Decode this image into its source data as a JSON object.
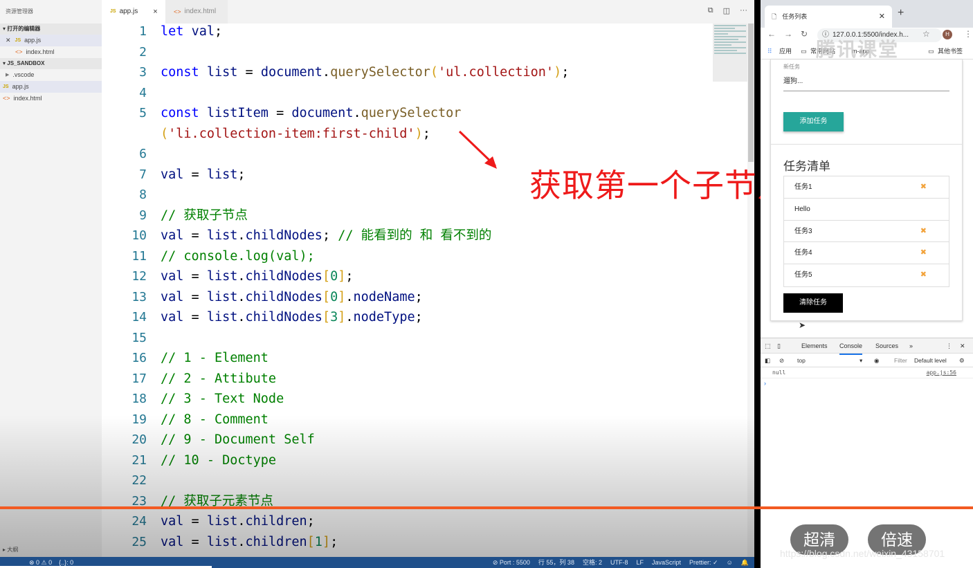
{
  "explorer": {
    "title": "资源管理器",
    "open_editors": "打开的编辑器",
    "open_files": [
      "app.js",
      "index.html"
    ],
    "workspace": "JS_SANDBOX",
    "tree": [
      ".vscode",
      "app.js",
      "index.html"
    ],
    "outline": "大纲"
  },
  "tabs": [
    {
      "label": "app.js",
      "close": "×"
    },
    {
      "label": "index.html"
    }
  ],
  "code": {
    "line_numbers": [
      "1",
      "2",
      "3",
      "4",
      "5",
      "",
      "6",
      "7",
      "8",
      "9",
      "10",
      "11",
      "12",
      "13",
      "14",
      "15",
      "16",
      "17",
      "18",
      "19",
      "20",
      "21",
      "22",
      "23",
      "24",
      "25"
    ],
    "lines": [
      [
        [
          "kw",
          "let "
        ],
        [
          "vr",
          "val"
        ],
        [
          "",
          "; "
        ]
      ],
      [],
      [
        [
          "kw",
          "const "
        ],
        [
          "vr",
          "list"
        ],
        [
          "",
          " = "
        ],
        [
          "vr",
          "document"
        ],
        [
          "",
          "."
        ],
        [
          "fn",
          "querySelector"
        ],
        [
          "br",
          "("
        ],
        [
          "st",
          "'ul.collection'"
        ],
        [
          "br",
          ")"
        ],
        [
          "",
          ";"
        ]
      ],
      [],
      [
        [
          "kw",
          "const "
        ],
        [
          "vr",
          "listItem"
        ],
        [
          "",
          " = "
        ],
        [
          "vr",
          "document"
        ],
        [
          "",
          "."
        ],
        [
          "fn",
          "querySelector"
        ]
      ],
      [
        [
          "br",
          "("
        ],
        [
          "st",
          "'li.collection-item:first-child'"
        ],
        [
          "br",
          ")"
        ],
        [
          "",
          ";"
        ]
      ],
      [],
      [
        [
          "vr",
          "val"
        ],
        [
          "",
          " = "
        ],
        [
          "vr",
          "list"
        ],
        [
          "",
          ";"
        ]
      ],
      [],
      [
        [
          "cm",
          "// 获取子节点"
        ]
      ],
      [
        [
          "vr",
          "val"
        ],
        [
          "",
          " = "
        ],
        [
          "vr",
          "list"
        ],
        [
          "",
          "."
        ],
        [
          "vr",
          "childNodes"
        ],
        [
          "",
          "; "
        ],
        [
          "cm",
          "// 能看到的 和 看不到的"
        ]
      ],
      [
        [
          "cm",
          "// console.log(val);"
        ]
      ],
      [
        [
          "vr",
          "val"
        ],
        [
          "",
          " = "
        ],
        [
          "vr",
          "list"
        ],
        [
          "",
          "."
        ],
        [
          "vr",
          "childNodes"
        ],
        [
          "br",
          "["
        ],
        [
          "nm",
          "0"
        ],
        [
          "br",
          "]"
        ],
        [
          "",
          ";"
        ]
      ],
      [
        [
          "vr",
          "val"
        ],
        [
          "",
          " = "
        ],
        [
          "vr",
          "list"
        ],
        [
          "",
          "."
        ],
        [
          "vr",
          "childNodes"
        ],
        [
          "br",
          "["
        ],
        [
          "nm",
          "0"
        ],
        [
          "br",
          "]"
        ],
        [
          "",
          "."
        ],
        [
          "vr",
          "nodeName"
        ],
        [
          "",
          ";"
        ]
      ],
      [
        [
          "vr",
          "val"
        ],
        [
          "",
          " = "
        ],
        [
          "vr",
          "list"
        ],
        [
          "",
          "."
        ],
        [
          "vr",
          "childNodes"
        ],
        [
          "br",
          "["
        ],
        [
          "nm",
          "3"
        ],
        [
          "br",
          "]"
        ],
        [
          "",
          "."
        ],
        [
          "vr",
          "nodeType"
        ],
        [
          "",
          ";"
        ]
      ],
      [],
      [
        [
          "cm",
          "// 1 - Element"
        ]
      ],
      [
        [
          "cm",
          "// 2 - Attibute"
        ]
      ],
      [
        [
          "cm",
          "// 3 - Text Node"
        ]
      ],
      [
        [
          "cm",
          "// 8 - Comment"
        ]
      ],
      [
        [
          "cm",
          "// 9 - Document Self"
        ]
      ],
      [
        [
          "cm",
          "// 10 - Doctype"
        ]
      ],
      [],
      [
        [
          "cm",
          "// 获取子元素节点"
        ]
      ],
      [
        [
          "vr",
          "val"
        ],
        [
          "",
          " = "
        ],
        [
          "vr",
          "list"
        ],
        [
          "",
          "."
        ],
        [
          "vr",
          "children"
        ],
        [
          "",
          ";"
        ]
      ],
      [
        [
          "vr",
          "val"
        ],
        [
          "",
          " = "
        ],
        [
          "vr",
          "list"
        ],
        [
          "",
          "."
        ],
        [
          "vr",
          "children"
        ],
        [
          "br",
          "["
        ],
        [
          "nm",
          "1"
        ],
        [
          "br",
          "]"
        ],
        [
          "",
          ";"
        ]
      ]
    ]
  },
  "annotation": "获取第一个子节点",
  "statusbar": {
    "left": [
      "⊗ 0 ⚠ 0",
      "{..}: 0"
    ],
    "right": [
      "⊘ Port : 5500",
      "行 55，列 38",
      "空格: 2",
      "UTF-8",
      "LF",
      "JavaScript",
      "Prettier: ✓"
    ]
  },
  "browser": {
    "tab_title": "任务列表",
    "url": "127.0.0.1:5500/index.h...",
    "bookmarks": [
      "应用",
      "常用网站",
      "m-app",
      "其他书签"
    ],
    "watermark": "腾讯课堂",
    "form_label": "新任务",
    "form_value": "遛狗...",
    "add_button": "添加任务",
    "list_title": "任务清单",
    "tasks": [
      {
        "text": "任务1",
        "del": "✖"
      },
      {
        "text": "Hello",
        "del": ""
      },
      {
        "text": "任务3",
        "del": "✖"
      },
      {
        "text": "任务4",
        "del": "✖"
      },
      {
        "text": "任务5",
        "del": "✖"
      }
    ],
    "clear_button": "清除任务"
  },
  "devtools": {
    "tabs": [
      "Elements",
      "Console",
      "Sources",
      "»"
    ],
    "context": "top",
    "filter": "Filter",
    "level": "Default level",
    "log_value": "null",
    "log_source": "app.js:56",
    "prompt": "›"
  },
  "video": {
    "quality": "超清",
    "speed": "倍速"
  },
  "source_watermark": "https://blog.csdn.net/weixin_43158701"
}
